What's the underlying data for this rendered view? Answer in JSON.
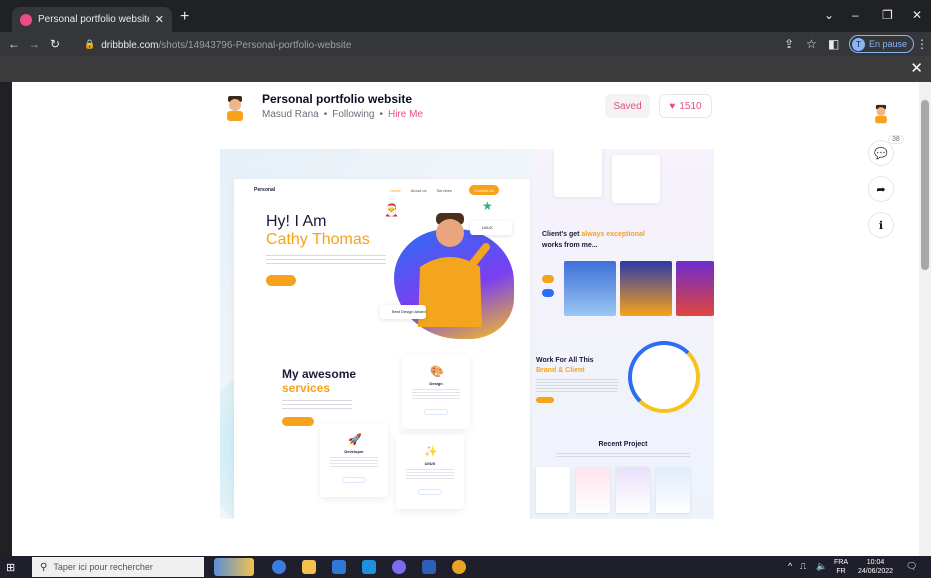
{
  "browser": {
    "tab_title": "Personal portfolio website by Ma",
    "url_host": "dribbble.com",
    "url_path": "/shots/14943796-Personal-portfolio-website",
    "profile_initial": "T",
    "profile_label": "En pause"
  },
  "shot": {
    "title": "Personal portfolio website",
    "author": "Masud Rana",
    "following": "Following",
    "hire": "Hire Me",
    "saved_label": "Saved",
    "likes": "1510",
    "comments_count": "38"
  },
  "design": {
    "nav_brand": "Personal",
    "nav_links": [
      "Home",
      "About us",
      "Services"
    ],
    "nav_button": "Contact Us",
    "hero_line1": "Hy! I Am",
    "hero_line2": "Cathy Thomas",
    "badge_uiux": "UI/UX",
    "badge_award": "Best Design Award",
    "services_line1": "My awesome",
    "services_line2": "services",
    "service_cards": [
      "Design",
      "Developer",
      "UI/UX"
    ],
    "clients_line1_a": "Client's get",
    "clients_line1_b": "always exceptional",
    "clients_line2": "works from me...",
    "work_line1": "Work For All This",
    "work_line2": "Brand & Client",
    "recent_title": "Recent Project"
  },
  "taskbar": {
    "search_placeholder": "Taper ici pour rechercher",
    "lang_line1": "FRA",
    "lang_line2": "FR",
    "time": "10:04",
    "date": "24/06/2022"
  },
  "colors": {
    "brand_pink": "#ea4c89",
    "design_orange": "#f7a21b",
    "design_navy": "#1b1b3a",
    "design_blue": "#2b6ef2"
  }
}
